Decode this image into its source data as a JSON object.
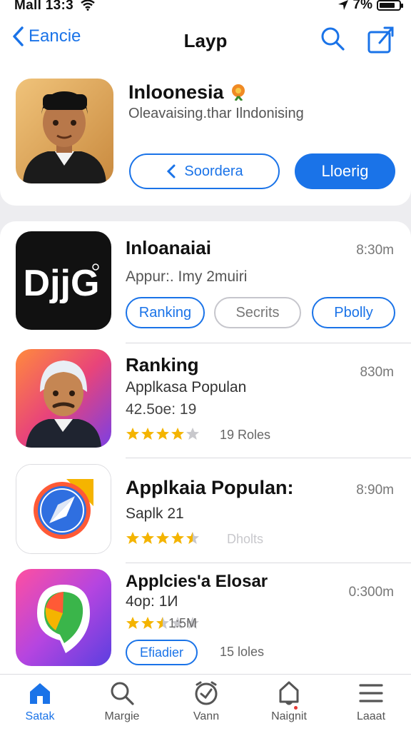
{
  "status": {
    "carrier_time": "Mall 13:3",
    "battery_text": "7%"
  },
  "nav": {
    "back_label": "Eancie",
    "title": "Layp"
  },
  "header": {
    "title": "Inloonesia",
    "subtitle": "Oleavaising.thar Ilndonising",
    "secondary_button": "Soordera",
    "primary_button": "Lloerig"
  },
  "list": [
    {
      "title": "Inloanaiai",
      "subtitle": "Appur:. Imy  2muiri",
      "time": "8:30m",
      "chips": [
        "Ranking",
        "Secrits",
        "Pbolly"
      ]
    },
    {
      "title": "Ranking",
      "subtitle": "Applkasa Populan",
      "detail": "42.5oe: 19",
      "time": "830m",
      "rating": 4,
      "meta": "19 Roles"
    },
    {
      "title": "Applkaia Populan:",
      "subtitle": "Saplk 21",
      "time": "8:90m",
      "rating": 4.5,
      "meta": "Dholts"
    },
    {
      "title": "Applcies'a Elosar",
      "subtitle": "4op: 1И",
      "time": "0:300m",
      "rating": 2.5,
      "rating_text": "1:5M",
      "chip": "Efiadier",
      "meta": "15 loles"
    }
  ],
  "tabs": [
    {
      "label": "Satak",
      "icon": "home-icon"
    },
    {
      "label": "Margie",
      "icon": "search-icon"
    },
    {
      "label": "Vann",
      "icon": "watch-icon"
    },
    {
      "label": "Naignit",
      "icon": "notification-icon"
    },
    {
      "label": "Laaat",
      "icon": "menu-icon"
    }
  ],
  "colors": {
    "accent": "#1a73e8",
    "star": "#f4b400",
    "star_empty": "#c8c8cc"
  }
}
